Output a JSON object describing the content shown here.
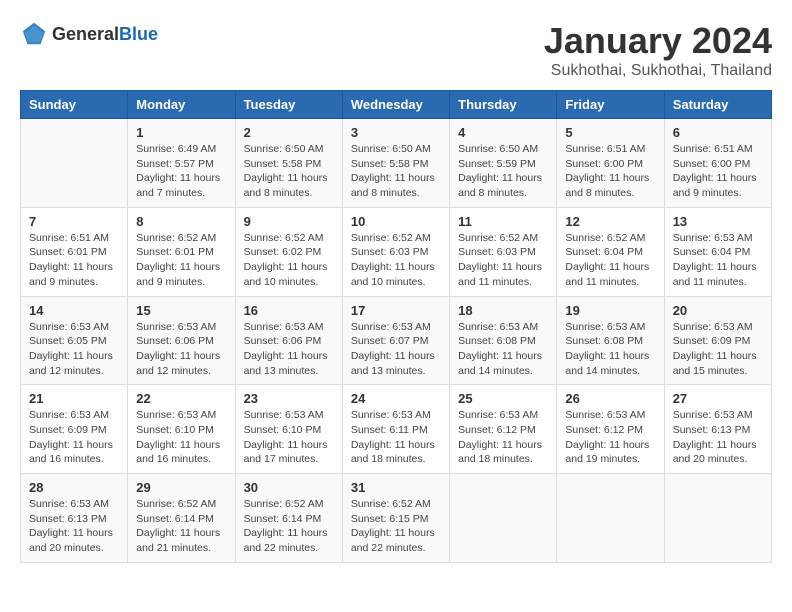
{
  "header": {
    "logo_general": "General",
    "logo_blue": "Blue",
    "month_year": "January 2024",
    "location": "Sukhothai, Sukhothai, Thailand"
  },
  "days_of_week": [
    "Sunday",
    "Monday",
    "Tuesday",
    "Wednesday",
    "Thursday",
    "Friday",
    "Saturday"
  ],
  "weeks": [
    [
      {
        "day": "",
        "info": ""
      },
      {
        "day": "1",
        "info": "Sunrise: 6:49 AM\nSunset: 5:57 PM\nDaylight: 11 hours\nand 7 minutes."
      },
      {
        "day": "2",
        "info": "Sunrise: 6:50 AM\nSunset: 5:58 PM\nDaylight: 11 hours\nand 8 minutes."
      },
      {
        "day": "3",
        "info": "Sunrise: 6:50 AM\nSunset: 5:58 PM\nDaylight: 11 hours\nand 8 minutes."
      },
      {
        "day": "4",
        "info": "Sunrise: 6:50 AM\nSunset: 5:59 PM\nDaylight: 11 hours\nand 8 minutes."
      },
      {
        "day": "5",
        "info": "Sunrise: 6:51 AM\nSunset: 6:00 PM\nDaylight: 11 hours\nand 8 minutes."
      },
      {
        "day": "6",
        "info": "Sunrise: 6:51 AM\nSunset: 6:00 PM\nDaylight: 11 hours\nand 9 minutes."
      }
    ],
    [
      {
        "day": "7",
        "info": "Sunrise: 6:51 AM\nSunset: 6:01 PM\nDaylight: 11 hours\nand 9 minutes."
      },
      {
        "day": "8",
        "info": "Sunrise: 6:52 AM\nSunset: 6:01 PM\nDaylight: 11 hours\nand 9 minutes."
      },
      {
        "day": "9",
        "info": "Sunrise: 6:52 AM\nSunset: 6:02 PM\nDaylight: 11 hours\nand 10 minutes."
      },
      {
        "day": "10",
        "info": "Sunrise: 6:52 AM\nSunset: 6:03 PM\nDaylight: 11 hours\nand 10 minutes."
      },
      {
        "day": "11",
        "info": "Sunrise: 6:52 AM\nSunset: 6:03 PM\nDaylight: 11 hours\nand 11 minutes."
      },
      {
        "day": "12",
        "info": "Sunrise: 6:52 AM\nSunset: 6:04 PM\nDaylight: 11 hours\nand 11 minutes."
      },
      {
        "day": "13",
        "info": "Sunrise: 6:53 AM\nSunset: 6:04 PM\nDaylight: 11 hours\nand 11 minutes."
      }
    ],
    [
      {
        "day": "14",
        "info": "Sunrise: 6:53 AM\nSunset: 6:05 PM\nDaylight: 11 hours\nand 12 minutes."
      },
      {
        "day": "15",
        "info": "Sunrise: 6:53 AM\nSunset: 6:06 PM\nDaylight: 11 hours\nand 12 minutes."
      },
      {
        "day": "16",
        "info": "Sunrise: 6:53 AM\nSunset: 6:06 PM\nDaylight: 11 hours\nand 13 minutes."
      },
      {
        "day": "17",
        "info": "Sunrise: 6:53 AM\nSunset: 6:07 PM\nDaylight: 11 hours\nand 13 minutes."
      },
      {
        "day": "18",
        "info": "Sunrise: 6:53 AM\nSunset: 6:08 PM\nDaylight: 11 hours\nand 14 minutes."
      },
      {
        "day": "19",
        "info": "Sunrise: 6:53 AM\nSunset: 6:08 PM\nDaylight: 11 hours\nand 14 minutes."
      },
      {
        "day": "20",
        "info": "Sunrise: 6:53 AM\nSunset: 6:09 PM\nDaylight: 11 hours\nand 15 minutes."
      }
    ],
    [
      {
        "day": "21",
        "info": "Sunrise: 6:53 AM\nSunset: 6:09 PM\nDaylight: 11 hours\nand 16 minutes."
      },
      {
        "day": "22",
        "info": "Sunrise: 6:53 AM\nSunset: 6:10 PM\nDaylight: 11 hours\nand 16 minutes."
      },
      {
        "day": "23",
        "info": "Sunrise: 6:53 AM\nSunset: 6:10 PM\nDaylight: 11 hours\nand 17 minutes."
      },
      {
        "day": "24",
        "info": "Sunrise: 6:53 AM\nSunset: 6:11 PM\nDaylight: 11 hours\nand 18 minutes."
      },
      {
        "day": "25",
        "info": "Sunrise: 6:53 AM\nSunset: 6:12 PM\nDaylight: 11 hours\nand 18 minutes."
      },
      {
        "day": "26",
        "info": "Sunrise: 6:53 AM\nSunset: 6:12 PM\nDaylight: 11 hours\nand 19 minutes."
      },
      {
        "day": "27",
        "info": "Sunrise: 6:53 AM\nSunset: 6:13 PM\nDaylight: 11 hours\nand 20 minutes."
      }
    ],
    [
      {
        "day": "28",
        "info": "Sunrise: 6:53 AM\nSunset: 6:13 PM\nDaylight: 11 hours\nand 20 minutes."
      },
      {
        "day": "29",
        "info": "Sunrise: 6:52 AM\nSunset: 6:14 PM\nDaylight: 11 hours\nand 21 minutes."
      },
      {
        "day": "30",
        "info": "Sunrise: 6:52 AM\nSunset: 6:14 PM\nDaylight: 11 hours\nand 22 minutes."
      },
      {
        "day": "31",
        "info": "Sunrise: 6:52 AM\nSunset: 6:15 PM\nDaylight: 11 hours\nand 22 minutes."
      },
      {
        "day": "",
        "info": ""
      },
      {
        "day": "",
        "info": ""
      },
      {
        "day": "",
        "info": ""
      }
    ]
  ]
}
